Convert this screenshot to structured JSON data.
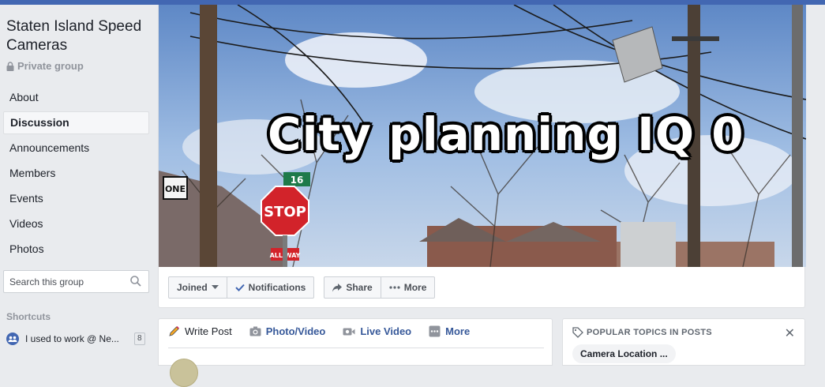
{
  "group": {
    "name": "Staten Island Speed Cameras",
    "privacy": "Private group"
  },
  "nav": [
    {
      "label": "About",
      "active": false
    },
    {
      "label": "Discussion",
      "active": true
    },
    {
      "label": "Announcements",
      "active": false
    },
    {
      "label": "Members",
      "active": false
    },
    {
      "label": "Events",
      "active": false
    },
    {
      "label": "Videos",
      "active": false
    },
    {
      "label": "Photos",
      "active": false
    }
  ],
  "search": {
    "placeholder": "Search this group"
  },
  "shortcuts": {
    "title": "Shortcuts",
    "items": [
      {
        "label": "I used to work @ Ne...",
        "badge": "8"
      }
    ]
  },
  "cover": {
    "title": "City planning IQ 0",
    "sign_stop": "STOP",
    "sign_all_way": "ALL WAY",
    "sign_one": "ONE",
    "sign_street": "16"
  },
  "actions": {
    "joined": "Joined",
    "notifications": "Notifications",
    "share": "Share",
    "more": "More"
  },
  "composer": {
    "write_post": "Write Post",
    "photo_video": "Photo/Video",
    "live_video": "Live Video",
    "more": "More"
  },
  "topics": {
    "title": "POPULAR TOPICS IN POSTS",
    "items": [
      "Camera Location ..."
    ]
  },
  "colors": {
    "accent": "#4267b2",
    "link": "#365899"
  }
}
